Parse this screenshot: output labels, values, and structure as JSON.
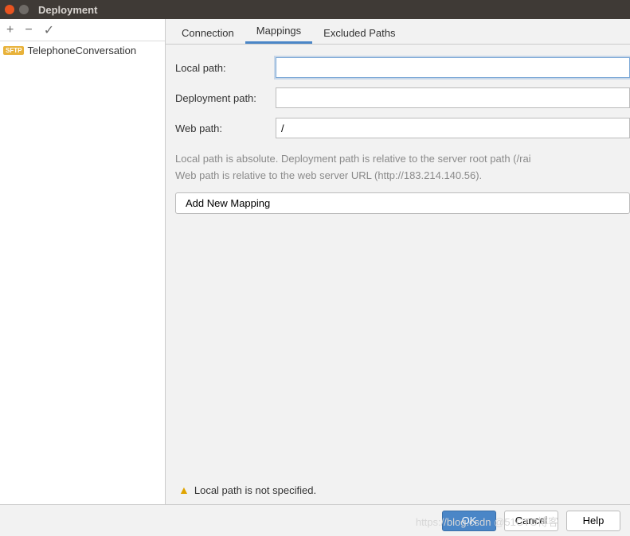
{
  "titlebar": {
    "title": "Deployment"
  },
  "sidebar": {
    "toolbar": {
      "add": "+",
      "remove": "−",
      "apply": "✓"
    },
    "items": [
      {
        "badge": "SFTP",
        "label": "TelephoneConversation"
      }
    ]
  },
  "tabs": {
    "items": [
      {
        "label": "Connection"
      },
      {
        "label": "Mappings",
        "active": true
      },
      {
        "label": "Excluded Paths"
      }
    ]
  },
  "form": {
    "local_path_label": "Local path:",
    "local_path_value": "",
    "deployment_path_label": "Deployment path:",
    "deployment_path_value": "",
    "web_path_label": "Web path:",
    "web_path_value": "/"
  },
  "help": {
    "line1": "Local path is absolute. Deployment path is relative to the server root path (/rai",
    "line2": "Web path is relative to the web server URL (http://183.214.140.56)."
  },
  "add_mapping_label": "Add New Mapping",
  "warning": {
    "text": "Local path is not specified."
  },
  "buttons": {
    "ok": "OK",
    "cancel": "Cancel",
    "help": "Help"
  },
  "watermark": "https://blog.csdn     @51CTO博客"
}
